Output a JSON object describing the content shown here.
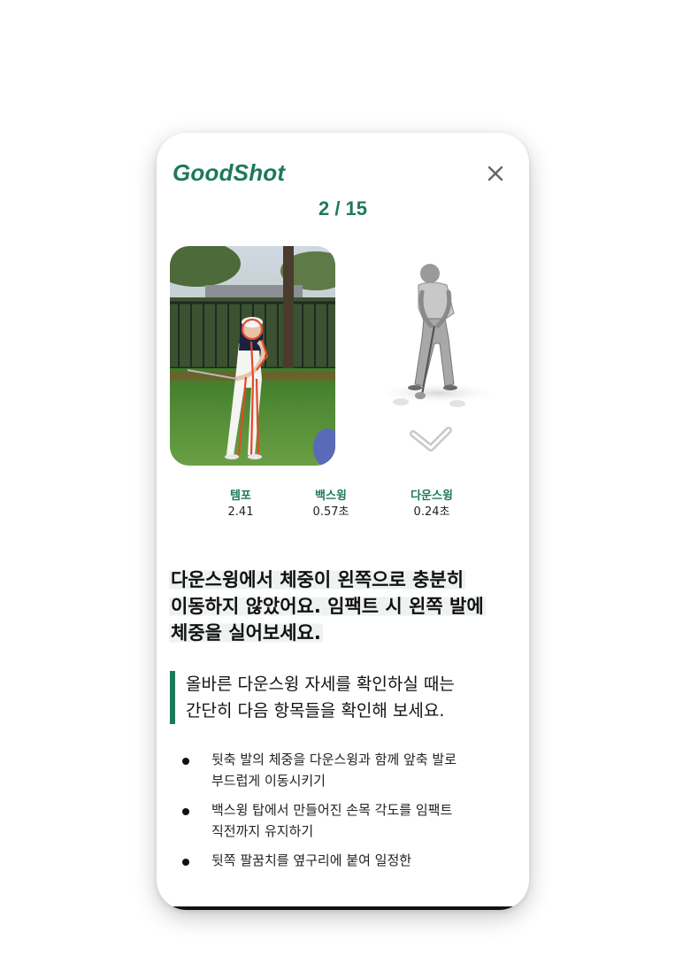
{
  "app": {
    "brand": "GoodShot",
    "progress": "2 / 15"
  },
  "icons": {
    "close": "close-icon",
    "check": "check-chevron-icon"
  },
  "colors": {
    "accent": "#1d7a58",
    "highlight": "#eef3ef",
    "text": "#111111"
  },
  "metrics": [
    {
      "label": "템포",
      "value": "2.41"
    },
    {
      "label": "백스윙",
      "value": "0.57초"
    },
    {
      "label": "다운스윙",
      "value": "0.24초"
    }
  ],
  "feedback": {
    "line1": "다운스윙에서 체중이 왼쪽으로 충분히",
    "line2": "이동하지 않았어요. 임팩트 시 왼쪽 발에",
    "line3": "체중을 실어보세요."
  },
  "quote": {
    "line1": "올바른 다운스윙 자세를 확인하실 때는",
    "line2": "간단히 다음 항목들을 확인해 보세요."
  },
  "tips": [
    {
      "line1": "뒷축 발의 체중을 다운스윙과 함께 앞축 발로",
      "line2": "부드럽게 이동시키기"
    },
    {
      "line1": "백스윙 탑에서 만들어진 손목 각도를 임팩트",
      "line2": "직전까지 유지하기"
    },
    {
      "line1": "뒷쪽 팔꿈치를 옆구리에 붙여 일정한",
      "line2": ""
    }
  ]
}
